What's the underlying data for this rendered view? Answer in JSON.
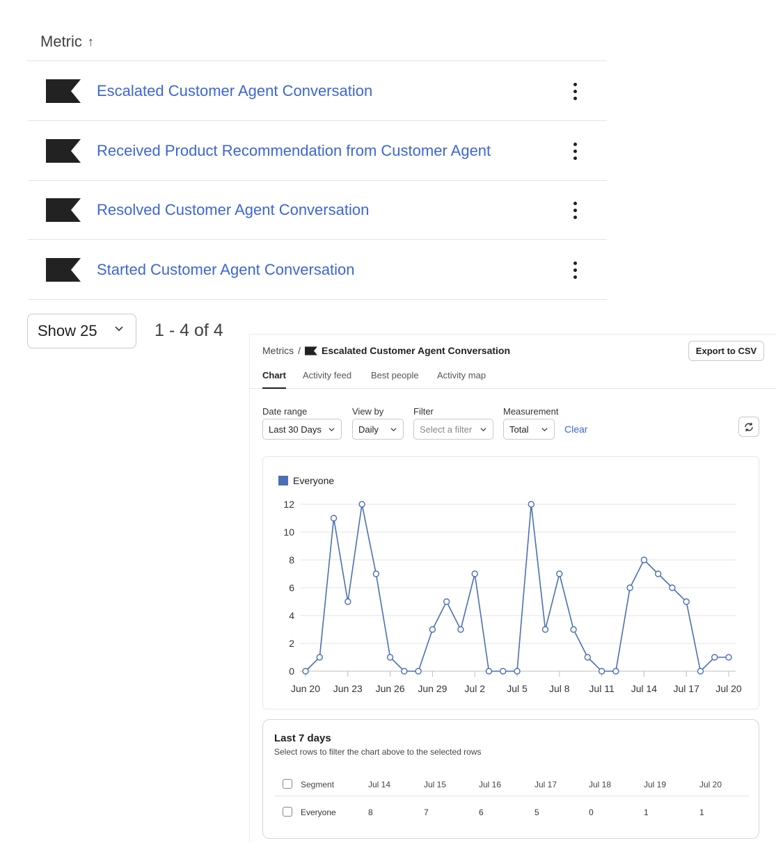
{
  "metrics_list": {
    "header": "Metric",
    "sort_icon": "arrow-up-icon",
    "items": [
      {
        "name": "Escalated Customer Agent Conversation"
      },
      {
        "name": "Received Product Recommendation from Customer Agent"
      },
      {
        "name": "Resolved Customer Agent Conversation"
      },
      {
        "name": "Started Customer Agent Conversation"
      }
    ],
    "page_size": "Show 25",
    "range_text": "1 - 4 of 4"
  },
  "detail": {
    "breadcrumb_root": "Metrics",
    "breadcrumb_sep": "/",
    "metric_title": "Escalated Customer Agent Conversation",
    "export_label": "Export to CSV",
    "tabs": [
      "Chart",
      "Activity feed",
      "Best people",
      "Activity map"
    ],
    "active_tab": "Chart",
    "filters": {
      "date_range": {
        "label": "Date range",
        "value": "Last 30 Days"
      },
      "view_by": {
        "label": "View by",
        "value": "Daily"
      },
      "filter": {
        "label": "Filter",
        "placeholder": "Select a filter"
      },
      "measurement": {
        "label": "Measurement",
        "value": "Total"
      }
    },
    "clear_label": "Clear",
    "refresh_icon": "refresh-icon",
    "table": {
      "title": "Last 7 days",
      "subtitle": "Select rows to filter the chart above to the selected rows",
      "columns": [
        "Segment",
        "Jul 14",
        "Jul 15",
        "Jul 16",
        "Jul 17",
        "Jul 18",
        "Jul 19",
        "Jul 20"
      ],
      "rows": [
        {
          "segment": "Everyone",
          "values": [
            "8",
            "7",
            "6",
            "5",
            "0",
            "1",
            "1"
          ]
        }
      ]
    }
  },
  "colors": {
    "link": "#3d66d6",
    "series": "#4a6fb5",
    "flag": "#222222"
  },
  "chart_data": {
    "type": "line",
    "ylim": [
      0,
      12
    ],
    "yticks": [
      0,
      2,
      4,
      6,
      8,
      10,
      12
    ],
    "xticks": [
      "Jun 20",
      "Jun 23",
      "Jun 26",
      "Jun 29",
      "Jul 2",
      "Jul 5",
      "Jul 8",
      "Jul 11",
      "Jul 14",
      "Jul 17",
      "Jul 20"
    ],
    "x": [
      "Jun 20",
      "Jun 21",
      "Jun 22",
      "Jun 23",
      "Jun 24",
      "Jun 25",
      "Jun 26",
      "Jun 27",
      "Jun 28",
      "Jun 29",
      "Jun 30",
      "Jul 1",
      "Jul 2",
      "Jul 3",
      "Jul 4",
      "Jul 5",
      "Jul 6",
      "Jul 7",
      "Jul 8",
      "Jul 9",
      "Jul 10",
      "Jul 11",
      "Jul 12",
      "Jul 13",
      "Jul 14",
      "Jul 15",
      "Jul 16",
      "Jul 17",
      "Jul 18",
      "Jul 19",
      "Jul 20"
    ],
    "series": [
      {
        "name": "Everyone",
        "values": [
          0,
          1,
          11,
          5,
          12,
          7,
          1,
          0,
          0,
          3,
          5,
          3,
          7,
          0,
          0,
          0,
          12,
          3,
          7,
          3,
          1,
          0,
          0,
          6,
          8,
          7,
          6,
          5,
          0,
          1,
          1
        ]
      }
    ],
    "legend": "top-left",
    "grid": true
  }
}
